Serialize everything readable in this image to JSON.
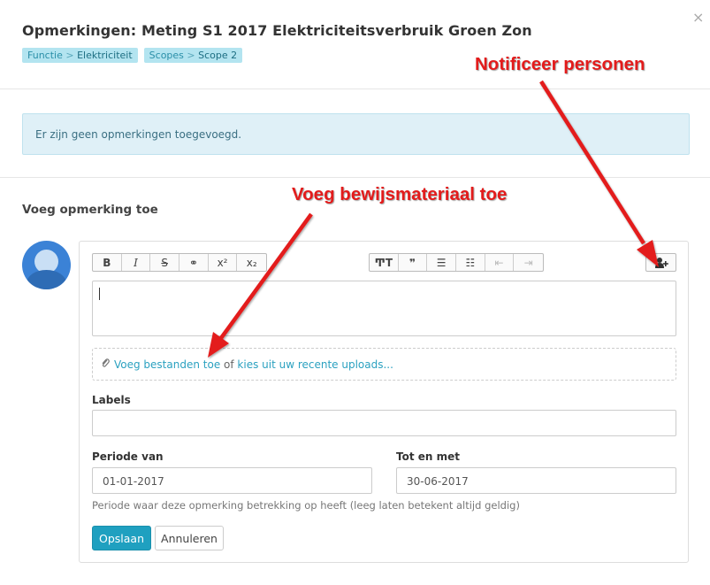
{
  "header": {
    "title": "Opmerkingen: Meting S1 2017 Elektriciteitsverbruik Groen Zon",
    "close_label": "×",
    "tags": [
      {
        "parent": "Functie",
        "sep": ">",
        "value": "Elektriciteit"
      },
      {
        "parent": "Scopes",
        "sep": ">",
        "value": "Scope 2"
      }
    ]
  },
  "notice": {
    "text": "Er zijn geen opmerkingen toegevoegd."
  },
  "form": {
    "section_title": "Voeg opmerking toe",
    "toolbar_left": [
      "bold",
      "italic",
      "strikethrough",
      "link",
      "superscript",
      "subscript"
    ],
    "toolbar_left_glyphs": [
      "B",
      "I",
      "S",
      "⚭",
      "x²",
      "x₂"
    ],
    "toolbar_middle": [
      "heading",
      "quote",
      "bullet-list",
      "numbered-list",
      "outdent",
      "indent"
    ],
    "toolbar_middle_glyphs": [
      "ͲT",
      "❞",
      "☰",
      "☷",
      "⇤",
      "⇥"
    ],
    "notify_icon": "notify-person-icon",
    "upload": {
      "clip_icon": "paperclip-icon",
      "add_files_link": "Voeg bestanden toe",
      "or_text": " of ",
      "recent_link": "kies uit uw recente uploads..."
    },
    "labels_label": "Labels",
    "labels_value": "",
    "period_from_label": "Periode van",
    "period_from_value": "01-01-2017",
    "period_to_label": "Tot en met",
    "period_to_value": "30-06-2017",
    "period_help": "Periode waar deze opmerking betrekking op heeft (leeg laten betekent altijd geldig)",
    "save_label": "Opslaan",
    "cancel_label": "Annuleren"
  },
  "annotations": {
    "notify": "Notificeer personen",
    "evidence": "Voeg bewijsmateriaal toe",
    "color": "#e31b1b"
  },
  "colors": {
    "accent": "#1fa0c0",
    "tag_bg": "#b3e4f0",
    "notice_bg": "#dff0f7",
    "avatar": "#3b82d6"
  }
}
